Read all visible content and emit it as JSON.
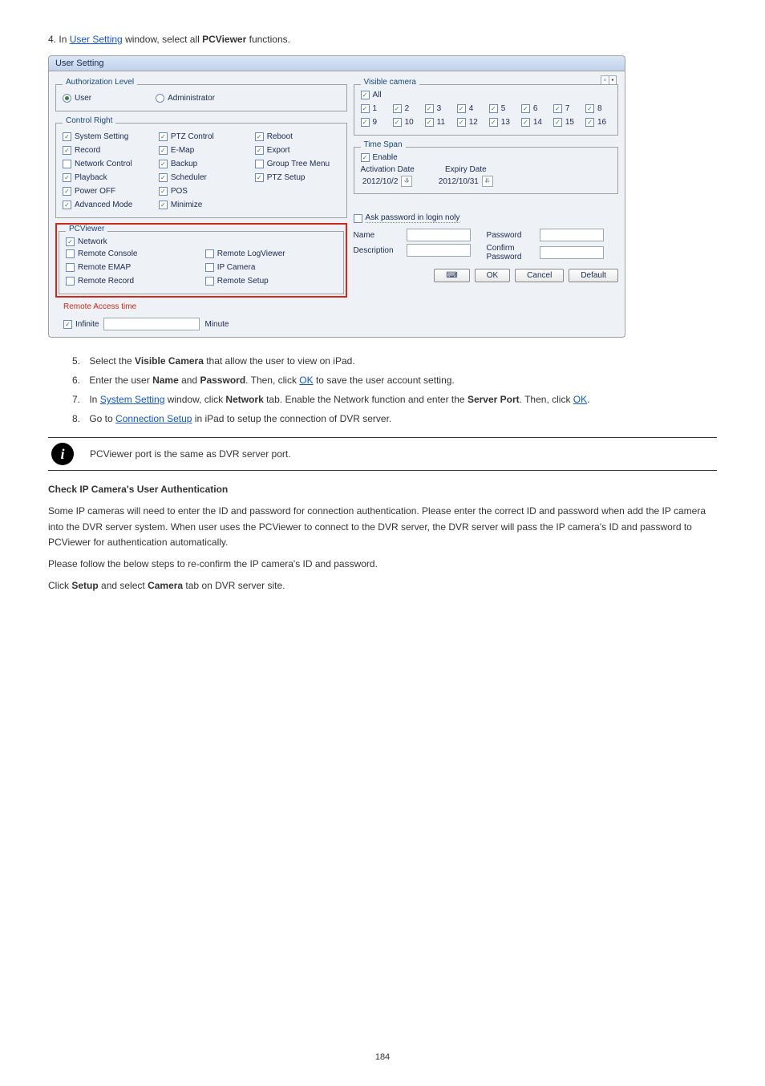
{
  "prelude": {
    "bullet_num": "4.",
    "text_before": "In ",
    "link": "User Setting",
    "text_after": " window, select all ",
    "bold": "PCViewer",
    "tail": " functions."
  },
  "dialog": {
    "title": "User Setting",
    "auth_level": {
      "legend": "Authorization Level",
      "user": "User",
      "admin": "Administrator"
    },
    "control_right": {
      "legend": "Control Right",
      "items": [
        {
          "label": "System Setting",
          "checked": true
        },
        {
          "label": "PTZ Control",
          "checked": true
        },
        {
          "label": "Reboot",
          "checked": true
        },
        {
          "label": "Record",
          "checked": true
        },
        {
          "label": "E-Map",
          "checked": true
        },
        {
          "label": "Export",
          "checked": true
        },
        {
          "label": "Network Control",
          "checked": false
        },
        {
          "label": "Backup",
          "checked": true
        },
        {
          "label": "Group Tree Menu",
          "checked": false
        },
        {
          "label": "Playback",
          "checked": true
        },
        {
          "label": "Scheduler",
          "checked": true
        },
        {
          "label": "PTZ Setup",
          "checked": true
        },
        {
          "label": "Power OFF",
          "checked": true
        },
        {
          "label": "POS",
          "checked": true
        },
        {
          "label": "",
          "checked": null
        },
        {
          "label": "Advanced Mode",
          "checked": true
        },
        {
          "label": "Minimize",
          "checked": true
        },
        {
          "label": "",
          "checked": null
        }
      ]
    },
    "pcviewer": {
      "legend": "PCViewer",
      "network": "Network",
      "items": [
        {
          "label": "Remote Console",
          "checked": false
        },
        {
          "label": "Remote LogViewer",
          "checked": false
        },
        {
          "label": "Remote EMAP",
          "checked": false
        },
        {
          "label": "IP Camera",
          "checked": false
        },
        {
          "label": "Remote Record",
          "checked": false
        },
        {
          "label": "Remote Setup",
          "checked": false
        }
      ],
      "rat_legend": "Remote Access time",
      "infinite": "Infinite",
      "minute": "Minute"
    },
    "visible": {
      "legend": "Visible camera",
      "all": "All",
      "cams": [
        "1",
        "2",
        "3",
        "4",
        "5",
        "6",
        "7",
        "8",
        "9",
        "10",
        "11",
        "12",
        "13",
        "14",
        "15",
        "16"
      ]
    },
    "timespan": {
      "legend": "Time Span",
      "enable": "Enable",
      "activation": "Activation Date",
      "act_date": "2012/10/2",
      "expiry": "Expiry Date",
      "exp_date": "2012/10/31"
    },
    "lower": {
      "ask_pwd": "Ask password in login noly",
      "name": "Name",
      "description": "Description",
      "password": "Password",
      "confirm": "Confirm Password"
    },
    "buttons": {
      "ok": "OK",
      "cancel": "Cancel",
      "default": "Default"
    }
  },
  "post": {
    "items": [
      {
        "n": "5.",
        "pre": "Select the ",
        "b": "Visible Camera",
        "post": " that allow the user to view on iPad."
      },
      {
        "n": "6.",
        "pre": "Enter the user ",
        "b": "Name",
        "post": " and ",
        "b2": "Password",
        "post2": ". Then, click ",
        "link": "OK",
        "tail": " to save the user account setting."
      },
      {
        "n": "7.",
        "pre": "In ",
        "link": "System Setting",
        "post": " window, click ",
        "b": "Network",
        "post2": " tab. Enable the Network function and enter the ",
        "b2": "Server Port",
        "tail": ". Then, click ",
        "link2": "OK",
        "tail2": "."
      },
      {
        "n": "8.",
        "pre": "Go to ",
        "link": "Connection Setup",
        "post": " in iPad to setup the connection of DVR server."
      }
    ]
  },
  "note": "PCViewer port is the same as DVR server port.",
  "section": {
    "title": "Check IP Camera's User Authentication",
    "p1": "Some IP cameras will need to enter the ID and password for connection authentication. Please enter the correct ID and password when add the IP camera into the DVR server system. When user uses the PCViewer to connect to the DVR server, the DVR server will pass the IP camera's ID and password to PCViewer for authentication automatically.",
    "p2": "Please follow the below steps to re-confirm the IP camera's ID and password.",
    "p3_pre": "Click ",
    "p3_b": "Setup",
    "p3_post": " and select ",
    "p3_b2": "Camera",
    "p3_tail": " tab on DVR server site."
  },
  "pagenum": "184"
}
